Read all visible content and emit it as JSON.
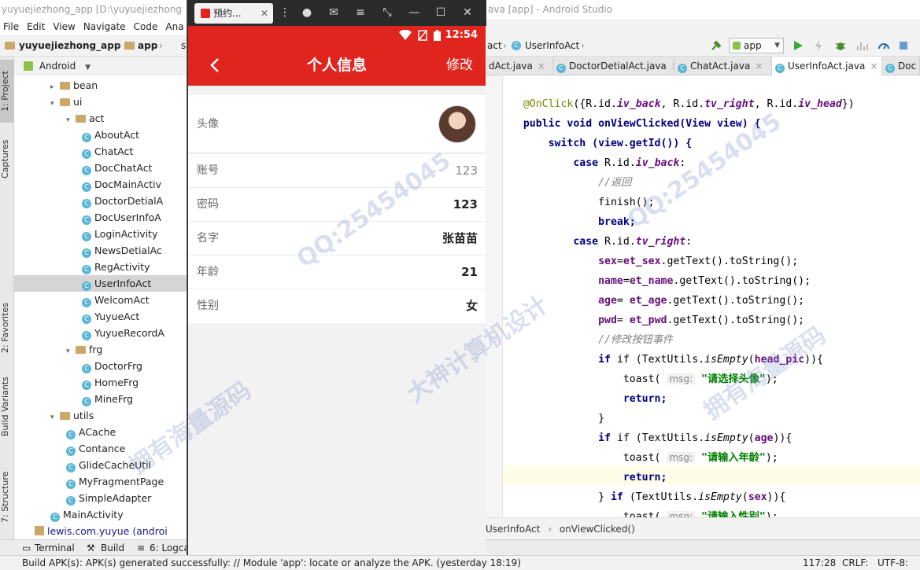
{
  "ide": {
    "window_title_left": "yuyuejiezhong_app [D:\\yuyuejiezhong",
    "window_title_right": "ava [app] - Android Studio",
    "menu": [
      "File",
      "Edit",
      "View",
      "Navigate",
      "Code",
      "Ana"
    ],
    "nav_crumbs": [
      "yuyuejiezhong_app",
      "app",
      "s"
    ],
    "nav_right_crumbs": [
      "act",
      "UserInfoAct"
    ],
    "run_config": "app",
    "project_view": "Android",
    "left_tabs": [
      "1: Project",
      "Captures",
      "2: Favorites",
      "Build Variants",
      "7: Structure"
    ],
    "tree": [
      {
        "label": "bean",
        "kind": "folder",
        "level": 3,
        "expanded": false
      },
      {
        "label": "ui",
        "kind": "folder",
        "level": 3,
        "expanded": true
      },
      {
        "label": "act",
        "kind": "folder",
        "level": 4,
        "expanded": true
      },
      {
        "label": "AboutAct",
        "kind": "class",
        "level": 5
      },
      {
        "label": "ChatAct",
        "kind": "class",
        "level": 5
      },
      {
        "label": "DocChatAct",
        "kind": "class",
        "level": 5
      },
      {
        "label": "DocMainActiv",
        "kind": "class",
        "level": 5
      },
      {
        "label": "DoctorDetialA",
        "kind": "class",
        "level": 5
      },
      {
        "label": "DocUserInfoA",
        "kind": "class",
        "level": 5
      },
      {
        "label": "LoginActivity",
        "kind": "class",
        "level": 5
      },
      {
        "label": "NewsDetialAc",
        "kind": "class",
        "level": 5
      },
      {
        "label": "RegActivity",
        "kind": "class",
        "level": 5
      },
      {
        "label": "UserInfoAct",
        "kind": "class",
        "level": 5,
        "selected": true
      },
      {
        "label": "WelcomAct",
        "kind": "class",
        "level": 5
      },
      {
        "label": "YuyueAct",
        "kind": "class",
        "level": 5
      },
      {
        "label": "YuyueRecordA",
        "kind": "class",
        "level": 5
      },
      {
        "label": "frg",
        "kind": "folder",
        "level": 4,
        "expanded": true
      },
      {
        "label": "DoctorFrg",
        "kind": "class",
        "level": 5
      },
      {
        "label": "HomeFrg",
        "kind": "class",
        "level": 5
      },
      {
        "label": "MineFrg",
        "kind": "class",
        "level": 5
      },
      {
        "label": "utils",
        "kind": "folder",
        "level": 3,
        "expanded": true
      },
      {
        "label": "ACache",
        "kind": "class",
        "level": 4
      },
      {
        "label": "Contance",
        "kind": "class",
        "level": 4
      },
      {
        "label": "GlideCacheUtil",
        "kind": "class",
        "level": 4
      },
      {
        "label": "MyFragmentPage",
        "kind": "class",
        "level": 4
      },
      {
        "label": "SimpleAdapter",
        "kind": "class",
        "level": 4
      },
      {
        "label": "MainActivity",
        "kind": "class",
        "level": 3
      },
      {
        "label": "lewis.com.yuyue (androi",
        "kind": "package",
        "level": 2
      }
    ],
    "editor_tabs": [
      {
        "label": "dAct.java"
      },
      {
        "label": "DoctorDetialAct.java"
      },
      {
        "label": "ChatAct.java"
      },
      {
        "label": "UserInfoAct.java",
        "active": true
      },
      {
        "label": "Doc"
      }
    ],
    "editor_breadcrumb": [
      "UserInfoAct",
      "onViewClicked()"
    ],
    "bottom_tools": [
      "Terminal",
      "Build",
      "6: Logcat"
    ],
    "status_message": "Build APK(s): APK(s) generated successfully: // Module 'app': locate or analyze the APK. (yesterday 18:19)",
    "caret_position": "117:28",
    "line_separator": "CRLF:",
    "encoding": "UTF-8:"
  },
  "code": {
    "l1_ann": "@OnClick",
    "l1_rest": "({R.id.",
    "l1_f1": "iv_back",
    "l1_m": ", R.id.",
    "l1_f2": "tv_right",
    "l1_m2": ", R.id.",
    "l1_f3": "iv_head",
    "l1_end": "})",
    "l2": "public void onViewClicked(View view) {",
    "l3": "switch (view.getId()) {",
    "l4_kw": "case",
    "l4_a": " R.id.",
    "l4_f": "iv_back",
    "l4_b": ":",
    "l5": "//返回",
    "l6": "finish();",
    "l7": "break;",
    "l8_kw": "case",
    "l8_a": " R.id.",
    "l8_f": "tv_right",
    "l8_b": ":",
    "l9_v": "sex",
    "l9_a": "=",
    "l9_v2": "et_sex",
    "l9_b": ".getText().toString();",
    "l10_v": "name",
    "l10_a": "=",
    "l10_v2": "et_name",
    "l10_b": ".getText().toString();",
    "l11_v": "age",
    "l11_a": "= ",
    "l11_v2": "et_age",
    "l11_b": ".getText().toString();",
    "l12_v": "pwd",
    "l12_a": "= ",
    "l12_v2": "et_pwd",
    "l12_b": ".getText().toString();",
    "l13": "//修改按钮事件",
    "l14_a": "if (TextUtils.",
    "l14_m": "isEmpty",
    "l14_b": "(",
    "l14_v": "head_pic",
    "l14_c": ")){",
    "l15_a": "toast(",
    "l15_hint": "msg:",
    "l15_s": "\"请选择头像\"",
    "l15_b": ");",
    "l16": "return;",
    "l17": "}",
    "l18_a": "if (TextUtils.",
    "l18_m": "isEmpty",
    "l18_b": "(",
    "l18_v": "age",
    "l18_c": ")){",
    "l19_a": "toast(",
    "l19_hint": "msg:",
    "l19_s": "\"请输入年龄\"",
    "l19_b": ");",
    "l20": "return;",
    "l21_a": "} ",
    "l21_kw": "if",
    "l21_b": " (TextUtils.",
    "l21_m": "isEmpty",
    "l21_c": "(",
    "l21_v": "sex",
    "l21_d": ")){",
    "l22_a": "toast(",
    "l22_hint": "msg:",
    "l22_s": "\"请输入性别\"",
    "l22_b": ");"
  },
  "emulator": {
    "window_tab": "预约...",
    "status_time": "12:54",
    "page_title": "个人信息",
    "edit_label": "修改",
    "rows": [
      {
        "label": "头像"
      },
      {
        "label": "账号",
        "value": "123"
      },
      {
        "label": "密码",
        "value": "123"
      },
      {
        "label": "名字",
        "value": "张苗苗"
      },
      {
        "label": "年龄",
        "value": "21"
      },
      {
        "label": "性别",
        "value": "女"
      }
    ]
  },
  "watermark": {
    "qq": "QQ:25454045",
    "t1": "大神计算机设计",
    "t2": "拥有海量源码"
  },
  "colors": {
    "app_red": "#e0251f",
    "selection": "#d5d5d5"
  }
}
